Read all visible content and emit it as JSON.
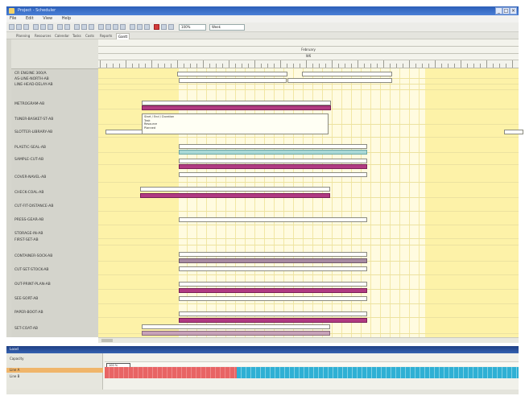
{
  "colors": {
    "titlebar": "#2c5fb8",
    "non_working": "#fdf2a8",
    "working": "#fffbe0",
    "bar_white": "#ffffff",
    "bar_purple": "#b13a82",
    "bar_teal": "#a8d8d6",
    "bar_lilac": "#a68aa2",
    "load_over": "#e86464",
    "load_ok": "#2fb0d4",
    "panel_title": "#1f3f84",
    "panel_row_highlight": "#f0b56a"
  },
  "titlebar": {
    "icon": "app-icon",
    "title": "Project - Scheduler",
    "buttons": [
      {
        "icon": "minimize-icon",
        "glyph": "_"
      },
      {
        "icon": "maximize-icon",
        "glyph": "□"
      },
      {
        "icon": "close-icon",
        "glyph": "×"
      }
    ]
  },
  "menu": [
    "File",
    "Edit",
    "View",
    "Help"
  ],
  "toolbar": {
    "zoom_value": "100%",
    "view_value": "Week"
  },
  "tabs": [
    "Planning",
    "Resources",
    "Calendar",
    "Tasks",
    "Costs",
    "Reports",
    "Gantt"
  ],
  "timeline": {
    "period": "February",
    "week": "W6"
  },
  "rows": [
    "CR ENGINE 300/A",
    "AS-LINE-NORTH-AB",
    "LINE-HEAD-DELAY-AB",
    "METROGRAM-AB",
    "TUNER-BASKET-ST-AB",
    "SLOTTER-LIBRARY-AB",
    "PLASTIC-SEAL-AB",
    "SAMPLE-CUT-AB",
    "COVER-NAVEL-AB",
    "CHECK-COAL-AB",
    "CUT-FIT-DISTANCE-AB",
    "PRESS-GEAR-AB",
    "STORAGE-IN-AB",
    "FIRST-SET-AB",
    "CONTAINER-SOCK-AB",
    "CUT-SET-STOCK-AB",
    "OUT-PRINT-PLAN-AB",
    "SEE-SORT-AB",
    "PAPER-BOOT-AB",
    "SET-COAT-AB"
  ],
  "popup": {
    "lines": [
      "Start / End / Duration",
      "Task",
      "Resource",
      "Planned"
    ]
  },
  "panel": {
    "title": "Load",
    "rows": [
      "Capacity",
      "Line A",
      "Line B"
    ],
    "marker": "100 %"
  }
}
